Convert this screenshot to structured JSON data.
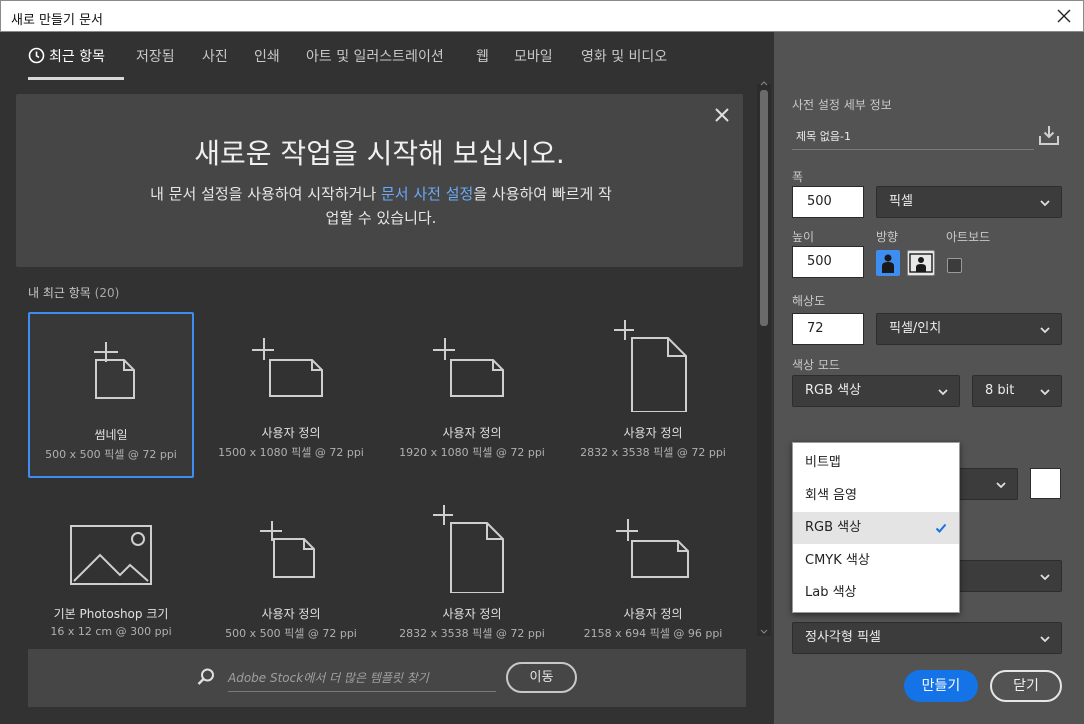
{
  "window": {
    "title": "새로 만들기 문서"
  },
  "tabs": [
    {
      "label": "최근 항목"
    },
    {
      "label": "저장됨"
    },
    {
      "label": "사진"
    },
    {
      "label": "인쇄"
    },
    {
      "label": "아트 및 일러스트레이션"
    },
    {
      "label": "웹"
    },
    {
      "label": "모바일"
    },
    {
      "label": "영화 및 비디오"
    }
  ],
  "welcome": {
    "heading": "새로운 작업을 시작해 보십시오.",
    "line1_pre": "내 문서 설정을 사용하여 시작하거나 ",
    "link": "문서 사전 설정",
    "line1_post": "을 사용하여 빠르게 작",
    "line2": "업할 수 있습니다."
  },
  "recent": {
    "label": "내 최근 항목",
    "count": "(20)",
    "items": [
      {
        "name": "썸네일",
        "size": "500 x 500 픽셀 @ 72 ppi"
      },
      {
        "name": "사용자 정의",
        "size": "1500 x 1080 픽셀 @ 72 ppi"
      },
      {
        "name": "사용자 정의",
        "size": "1920 x 1080 픽셀 @ 72 ppi"
      },
      {
        "name": "사용자 정의",
        "size": "2832 x 3538 픽셀 @ 72 ppi"
      },
      {
        "name": "기본 Photoshop 크기",
        "size": "16 x 12 cm @ 300 ppi"
      },
      {
        "name": "사용자 정의",
        "size": "500 x 500 픽셀 @ 72 ppi"
      },
      {
        "name": "사용자 정의",
        "size": "2832 x 3538 픽셀 @ 72 ppi"
      },
      {
        "name": "사용자 정의",
        "size": "2158 x 694 픽셀 @ 96 ppi"
      }
    ]
  },
  "stock": {
    "placeholder": "Adobe Stock에서 더 많은 템플릿 찾기",
    "button": "이동"
  },
  "preset": {
    "title": "사전 설정 세부 정보",
    "doc_name": "제목 없음-1",
    "width_label": "폭",
    "width_value": "500",
    "width_unit": "픽셀",
    "height_label": "높이",
    "height_value": "500",
    "orientation_label": "방향",
    "artboard_label": "아트보드",
    "resolution_label": "해상도",
    "resolution_value": "72",
    "resolution_unit": "픽셀/인치",
    "color_mode_label": "색상 모드",
    "color_mode_value": "RGB 색상",
    "bit_depth": "8 bit",
    "color_mode_options": [
      "비트맵",
      "회색 음영",
      "RGB 색상",
      "CMYK 색상",
      "Lab 색상"
    ],
    "selected_option": "RGB 색상",
    "pixel_aspect": "정사각형 픽셀"
  },
  "buttons": {
    "create": "만들기",
    "close": "닫기"
  },
  "colors": {
    "accent": "#1473e6",
    "selection": "#3d8ef0",
    "link": "#6aa9f5",
    "panel_dark": "#323232",
    "panel_mid": "#535353"
  }
}
